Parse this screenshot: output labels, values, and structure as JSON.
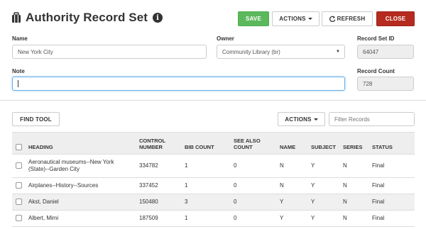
{
  "header": {
    "title": "Authority Record Set",
    "icon": "briefcase-icon",
    "info_icon": "info-icon",
    "info_glyph": "i"
  },
  "toolbar": {
    "save_label": "SAVE",
    "actions_label": "ACTIONS",
    "refresh_label": "REFRESH",
    "close_label": "CLOSE"
  },
  "form": {
    "name_label": "Name",
    "name_value": "New York City",
    "owner_label": "Owner",
    "owner_value": "Community Library (br)",
    "record_set_id_label": "Record Set ID",
    "record_set_id_value": "64047",
    "note_label": "Note",
    "note_value": "",
    "record_count_label": "Record Count",
    "record_count_value": "728"
  },
  "table_toolbar": {
    "find_tool_label": "FIND TOOL",
    "actions_label": "ACTIONS",
    "filter_placeholder": "Filter Records"
  },
  "table": {
    "columns": [
      "HEADING",
      "CONTROL NUMBER",
      "BIB COUNT",
      "SEE ALSO COUNT",
      "NAME",
      "SUBJECT",
      "SERIES",
      "STATUS"
    ],
    "rows": [
      {
        "heading": "Aeronautical museums--New York (State)--Garden City",
        "control_number": "334782",
        "bib_count": "1",
        "see_also_count": "0",
        "name": "N",
        "subject": "Y",
        "series": "N",
        "status": "Final"
      },
      {
        "heading": "Airplanes--History--Sources",
        "control_number": "337452",
        "bib_count": "1",
        "see_also_count": "0",
        "name": "N",
        "subject": "Y",
        "series": "N",
        "status": "Final"
      },
      {
        "heading": "Akst, Daniel",
        "control_number": "150480",
        "bib_count": "3",
        "see_also_count": "0",
        "name": "Y",
        "subject": "Y",
        "series": "N",
        "status": "Final"
      },
      {
        "heading": "Albert, Mimi",
        "control_number": "187509",
        "bib_count": "1",
        "see_also_count": "0",
        "name": "Y",
        "subject": "Y",
        "series": "N",
        "status": "Final"
      }
    ]
  },
  "colors": {
    "save": "#5cb85c",
    "close": "#b52b1f",
    "focus": "#66afe9"
  }
}
